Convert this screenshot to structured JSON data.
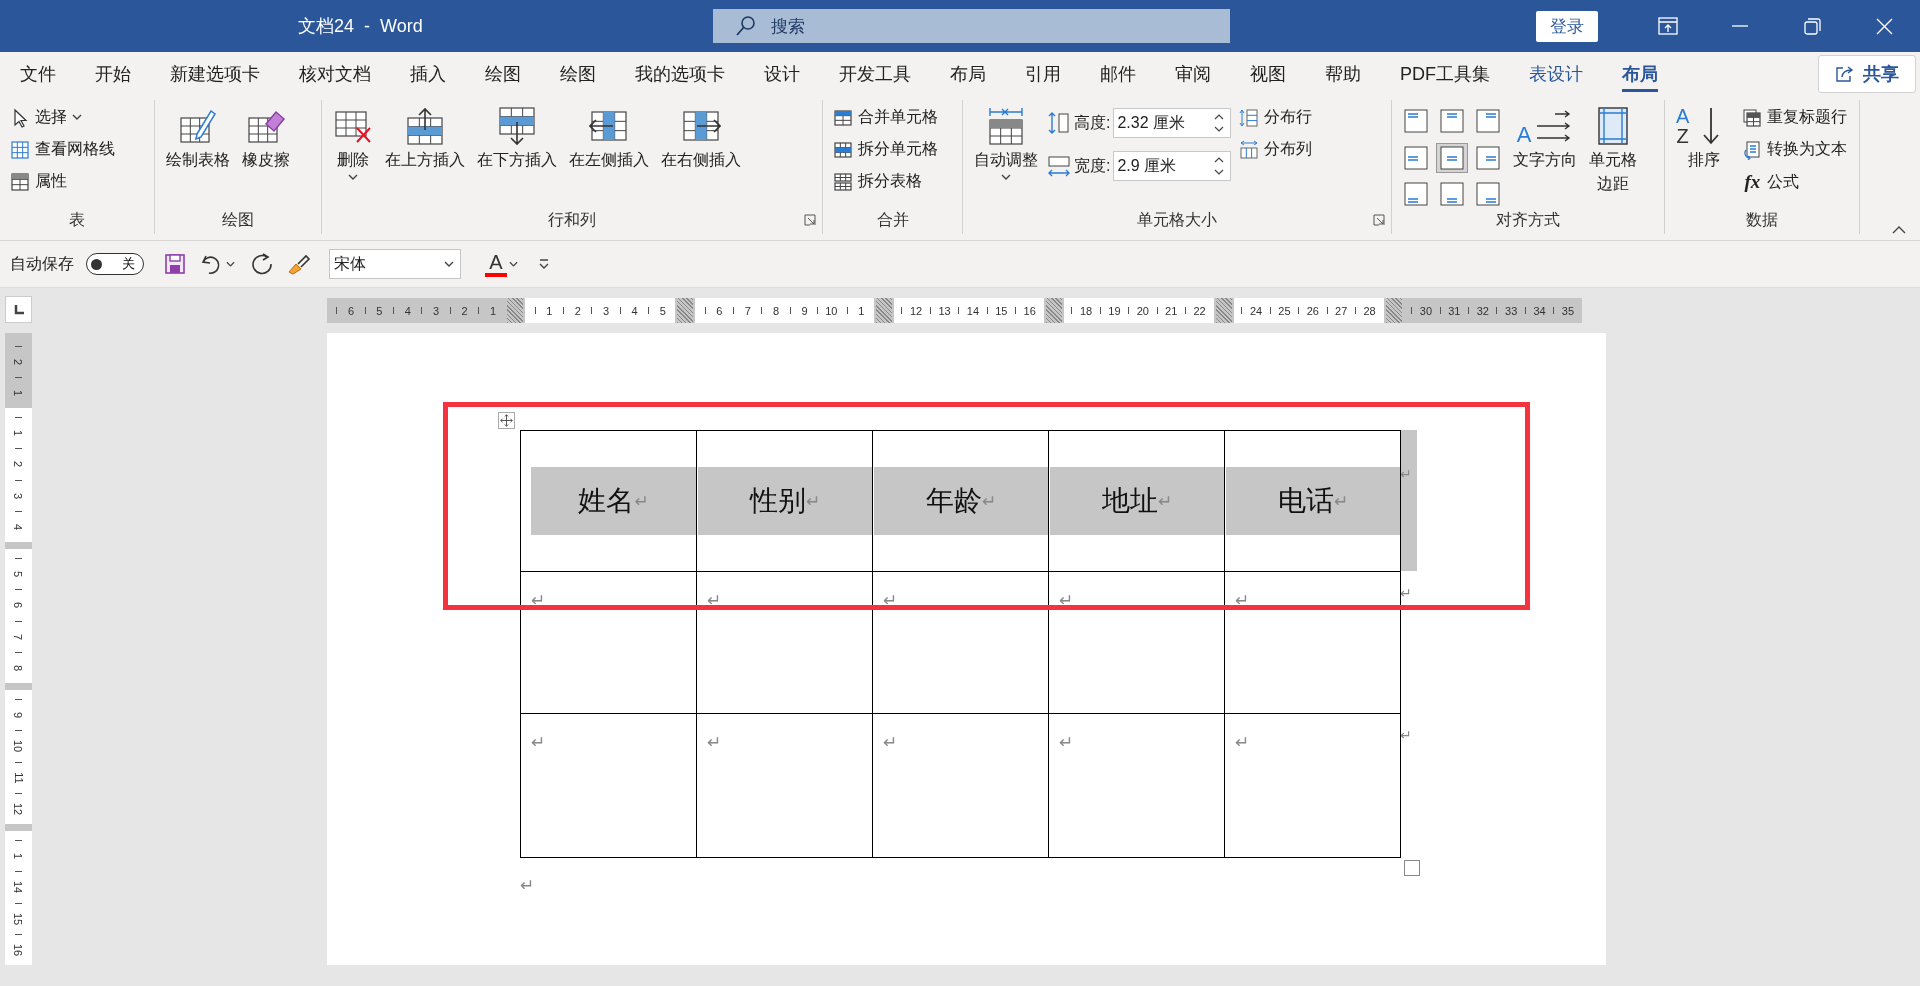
{
  "window": {
    "title": "文档24  -  Word",
    "search": {
      "placeholder": "搜索"
    },
    "sign_in": "登录"
  },
  "tabs": [
    {
      "label": "文件",
      "selected": false,
      "contextual": false
    },
    {
      "label": "开始",
      "selected": false,
      "contextual": false
    },
    {
      "label": "新建选项卡",
      "selected": false,
      "contextual": false
    },
    {
      "label": "核对文档",
      "selected": false,
      "contextual": false
    },
    {
      "label": "插入",
      "selected": false,
      "contextual": false
    },
    {
      "label": "绘图",
      "selected": false,
      "contextual": false
    },
    {
      "label": "绘图",
      "selected": false,
      "contextual": false
    },
    {
      "label": "我的选项卡",
      "selected": false,
      "contextual": false
    },
    {
      "label": "设计",
      "selected": false,
      "contextual": false
    },
    {
      "label": "开发工具",
      "selected": false,
      "contextual": false
    },
    {
      "label": "布局",
      "selected": false,
      "contextual": false
    },
    {
      "label": "引用",
      "selected": false,
      "contextual": false
    },
    {
      "label": "邮件",
      "selected": false,
      "contextual": false
    },
    {
      "label": "审阅",
      "selected": false,
      "contextual": false
    },
    {
      "label": "视图",
      "selected": false,
      "contextual": false
    },
    {
      "label": "帮助",
      "selected": false,
      "contextual": false
    },
    {
      "label": "PDF工具集",
      "selected": false,
      "contextual": false
    },
    {
      "label": "表设计",
      "selected": false,
      "contextual": true
    },
    {
      "label": "布局",
      "selected": true,
      "contextual": true
    }
  ],
  "share": "共享",
  "ribbon": {
    "groups": [
      {
        "label": "表",
        "launcher": false,
        "items": [
          {
            "kind": "small",
            "label": "选择",
            "dropdown": true
          },
          {
            "kind": "small",
            "label": "查看网格线",
            "dropdown": false
          },
          {
            "kind": "small",
            "label": "属性",
            "dropdown": false
          }
        ]
      },
      {
        "label": "绘图",
        "launcher": false,
        "items": [
          {
            "kind": "large",
            "label": "绘制表格",
            "dropdown": false
          },
          {
            "kind": "large",
            "label": "橡皮擦",
            "dropdown": false
          }
        ]
      },
      {
        "label": "行和列",
        "launcher": true,
        "items": [
          {
            "kind": "large",
            "label": "删除",
            "dropdown": true
          },
          {
            "kind": "large",
            "label": "在上方插入",
            "dropdown": false
          },
          {
            "kind": "large",
            "label": "在下方插入",
            "dropdown": false
          },
          {
            "kind": "large",
            "label": "在左侧插入",
            "dropdown": false
          },
          {
            "kind": "large",
            "label": "在右侧插入",
            "dropdown": false
          }
        ]
      },
      {
        "label": "合并",
        "launcher": false,
        "items": [
          {
            "kind": "small",
            "label": "合并单元格",
            "dropdown": false
          },
          {
            "kind": "small",
            "label": "拆分单元格",
            "dropdown": false
          },
          {
            "kind": "small",
            "label": "拆分表格",
            "dropdown": false
          }
        ]
      },
      {
        "label": "单元格大小",
        "launcher": true,
        "items": [
          {
            "kind": "large",
            "label": "自动调整",
            "dropdown": true
          },
          {
            "kind": "field",
            "label": "高度:",
            "value": "2.32 厘米"
          },
          {
            "kind": "field",
            "label": "宽度:",
            "value": "2.9 厘米"
          },
          {
            "kind": "small",
            "label": "分布行",
            "dropdown": false
          },
          {
            "kind": "small",
            "label": "分布列",
            "dropdown": false
          }
        ]
      },
      {
        "label": "对齐方式",
        "launcher": false,
        "items": [
          {
            "kind": "align",
            "cells": [
              {
                "selected": false
              },
              {
                "selected": false
              },
              {
                "selected": false
              },
              {
                "selected": false
              },
              {
                "selected": true
              },
              {
                "selected": false
              },
              {
                "selected": false
              },
              {
                "selected": false
              },
              {
                "selected": false
              }
            ]
          },
          {
            "kind": "large",
            "label": "文字方向",
            "dropdown": false,
            "glyph": "A"
          },
          {
            "kind": "large",
            "lines": [
              "单元格",
              "边距"
            ],
            "dropdown": false
          }
        ]
      },
      {
        "label": "数据",
        "launcher": false,
        "items": [
          {
            "kind": "large",
            "label": "排序",
            "dropdown": false,
            "glyphs": [
              "A",
              "Z"
            ]
          },
          {
            "kind": "small",
            "label": "重复标题行",
            "dropdown": false
          },
          {
            "kind": "small",
            "label": "转换为文本",
            "dropdown": false
          },
          {
            "kind": "small",
            "label": "公式",
            "dropdown": false,
            "glyph": "fx"
          }
        ]
      }
    ]
  },
  "quick_access": [
    {
      "kind": "label",
      "text": "自动保存"
    },
    {
      "kind": "toggle",
      "on": false,
      "text": "关"
    },
    {
      "kind": "save"
    },
    {
      "kind": "undo",
      "dropdown": true
    },
    {
      "kind": "redo"
    },
    {
      "kind": "painter"
    },
    {
      "kind": "font",
      "value": "宋体"
    },
    {
      "kind": "font-color",
      "glyph": "A",
      "color": "#ff0000",
      "dropdown": true
    },
    {
      "kind": "customize"
    }
  ],
  "rulers": {
    "horizontal": [
      {
        "shaded": true,
        "ticks": [
          "6",
          "5",
          "4",
          "3",
          "2",
          "1"
        ]
      },
      {
        "shaded": false,
        "ticks": [
          "1",
          "2",
          "3",
          "4",
          "5"
        ]
      },
      {
        "shaded": false,
        "ticks": [
          "6",
          "7",
          "8",
          "9",
          "10",
          "1"
        ]
      },
      {
        "shaded": false,
        "ticks": [
          "12",
          "13",
          "14",
          "15",
          "16"
        ]
      },
      {
        "shaded": false,
        "ticks": [
          "18",
          "19",
          "20",
          "21",
          "22"
        ]
      },
      {
        "shaded": false,
        "ticks": [
          "24",
          "25",
          "26",
          "27",
          "28"
        ]
      },
      {
        "shaded": true,
        "ticks": [
          "30",
          "31",
          "32",
          "33",
          "34",
          "35"
        ]
      }
    ],
    "vertical": [
      {
        "shaded": true,
        "ticks": [
          "2",
          "1"
        ]
      },
      {
        "shaded": false,
        "ticks": [
          "1",
          "2",
          "3",
          "4"
        ]
      },
      {
        "shaded": false,
        "ticks": [
          "5",
          "6",
          "7",
          "8"
        ]
      },
      {
        "shaded": false,
        "ticks": [
          "9",
          "10",
          "11",
          "12"
        ]
      },
      {
        "shaded": false,
        "ticks": [
          "1",
          "14",
          "15",
          "16"
        ]
      }
    ]
  },
  "document": {
    "table": {
      "rows": [
        {
          "selected": true,
          "end_mark": "↵",
          "cells": [
            {
              "text": "姓名",
              "mark": "↵"
            },
            {
              "text": "性别",
              "mark": "↵"
            },
            {
              "text": "年龄",
              "mark": "↵"
            },
            {
              "text": "地址",
              "mark": "↵"
            },
            {
              "text": "电话",
              "mark": "↵"
            }
          ]
        },
        {
          "selected": false,
          "end_mark": "↵",
          "cells": [
            {
              "mark": "↵"
            },
            {
              "mark": "↵"
            },
            {
              "mark": "↵"
            },
            {
              "mark": "↵"
            },
            {
              "mark": "↵"
            }
          ]
        },
        {
          "selected": false,
          "end_mark": "↵",
          "cells": [
            {
              "mark": "↵"
            },
            {
              "mark": "↵"
            },
            {
              "mark": "↵"
            },
            {
              "mark": "↵"
            },
            {
              "mark": "↵"
            }
          ]
        }
      ]
    },
    "trailing_mark": "↵"
  }
}
